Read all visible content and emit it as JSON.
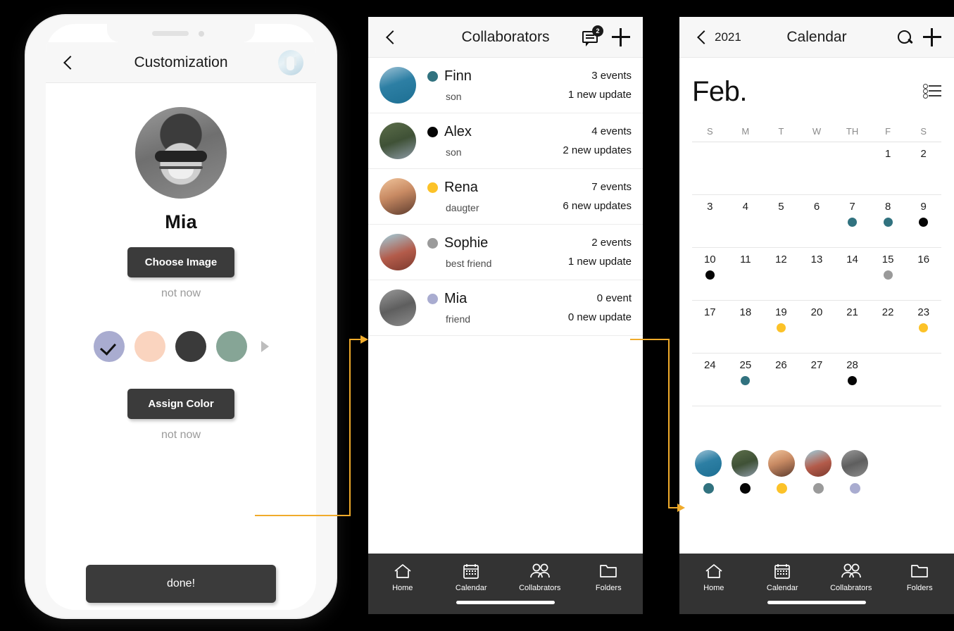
{
  "colors": {
    "dark_button": "#3b3b3b",
    "nav_bg": "#333333",
    "accent_connector": "#f0ab2b",
    "teal": "#31727f",
    "black": "#050505",
    "yellow": "#fcc228",
    "gray": "#9a9a9a",
    "periwinkle": "#a9acd0",
    "peach": "#fad4bf",
    "charcoal": "#3a3a3a",
    "sage": "#86a596"
  },
  "phone1": {
    "header": {
      "back_icon": "chevron-left-icon",
      "title": "Customization",
      "avatar_icon": "user-avatar"
    },
    "profile": {
      "name": "Mia",
      "avatar_icon": "profile-photo"
    },
    "choose_image_button": "Choose Image",
    "choose_image_skip": "not now",
    "swatches": [
      {
        "name": "periwinkle",
        "hex": "#a9acd0",
        "selected": true
      },
      {
        "name": "peach",
        "hex": "#fad4bf",
        "selected": false
      },
      {
        "name": "charcoal",
        "hex": "#3a3a3a",
        "selected": false
      },
      {
        "name": "sage",
        "hex": "#86a596",
        "selected": false
      }
    ],
    "swatch_next_icon": "chevron-right-icon",
    "assign_color_button": "Assign Color",
    "assign_color_skip": "not now",
    "done_button": "done!"
  },
  "phone2": {
    "header": {
      "back_icon": "chevron-left-icon",
      "title": "Collaborators",
      "chat_icon": "chat-bubble-icon",
      "chat_badge": "2",
      "add_icon": "plus-icon"
    },
    "collaborators": [
      {
        "name": "Finn",
        "relation": "son",
        "events": "3 events",
        "updates": "1 new update",
        "dot": "#31727f",
        "avatar": "photo-finn"
      },
      {
        "name": "Alex",
        "relation": "son",
        "events": "4 events",
        "updates": "2 new updates",
        "dot": "#050505",
        "avatar": "photo-alex"
      },
      {
        "name": "Rena",
        "relation": "daugter",
        "events": "7 events",
        "updates": "6 new updates",
        "dot": "#fcc228",
        "avatar": "photo-rena"
      },
      {
        "name": "Sophie",
        "relation": "best friend",
        "events": "2 events",
        "updates": "1 new update",
        "dot": "#9a9a9a",
        "avatar": "photo-sophie"
      },
      {
        "name": "Mia",
        "relation": "friend",
        "events": "0 event",
        "updates": "0 new update",
        "dot": "#a9acd0",
        "avatar": "photo-mia"
      }
    ]
  },
  "phone3": {
    "header": {
      "back_icon": "chevron-left-icon",
      "year": "2021",
      "title": "Calendar",
      "search_icon": "search-icon",
      "add_icon": "plus-icon"
    },
    "month": "Feb.",
    "list_view_icon": "list-view-icon",
    "weekdays": [
      "S",
      "M",
      "T",
      "W",
      "TH",
      "F",
      "S"
    ],
    "weeks": [
      [
        {
          "day": ""
        },
        {
          "day": ""
        },
        {
          "day": ""
        },
        {
          "day": ""
        },
        {
          "day": ""
        },
        {
          "day": "1"
        },
        {
          "day": "2"
        }
      ],
      [
        {
          "day": "3"
        },
        {
          "day": "4"
        },
        {
          "day": "5"
        },
        {
          "day": "6"
        },
        {
          "day": "7",
          "dot": "#31727f"
        },
        {
          "day": "8",
          "dot": "#31727f"
        },
        {
          "day": "9",
          "dot": "#050505"
        }
      ],
      [
        {
          "day": "10",
          "dot": "#050505"
        },
        {
          "day": "11"
        },
        {
          "day": "12"
        },
        {
          "day": "13"
        },
        {
          "day": "14"
        },
        {
          "day": "15",
          "dot": "#9a9a9a"
        },
        {
          "day": "16"
        }
      ],
      [
        {
          "day": "17"
        },
        {
          "day": "18"
        },
        {
          "day": "19",
          "dot": "#fcc228"
        },
        {
          "day": "20"
        },
        {
          "day": "21"
        },
        {
          "day": "22"
        },
        {
          "day": "23",
          "dot": "#fcc228"
        }
      ],
      [
        {
          "day": "24"
        },
        {
          "day": "25",
          "dot": "#31727f"
        },
        {
          "day": "26"
        },
        {
          "day": "27"
        },
        {
          "day": "28",
          "dot": "#050505"
        },
        {
          "day": ""
        },
        {
          "day": ""
        }
      ]
    ],
    "avatars": [
      {
        "avatar": "photo-finn",
        "dot": "#31727f"
      },
      {
        "avatar": "photo-alex",
        "dot": "#050505"
      },
      {
        "avatar": "photo-rena",
        "dot": "#fcc228"
      },
      {
        "avatar": "photo-sophie",
        "dot": "#9a9a9a"
      },
      {
        "avatar": "photo-mia",
        "dot": "#a9acd0"
      }
    ]
  },
  "bottom_nav": [
    {
      "label": "Home",
      "icon": "home-icon"
    },
    {
      "label": "Calendar",
      "icon": "calendar-icon"
    },
    {
      "label": "Collabrators",
      "icon": "people-icon"
    },
    {
      "label": "Folders",
      "icon": "folder-icon"
    }
  ]
}
